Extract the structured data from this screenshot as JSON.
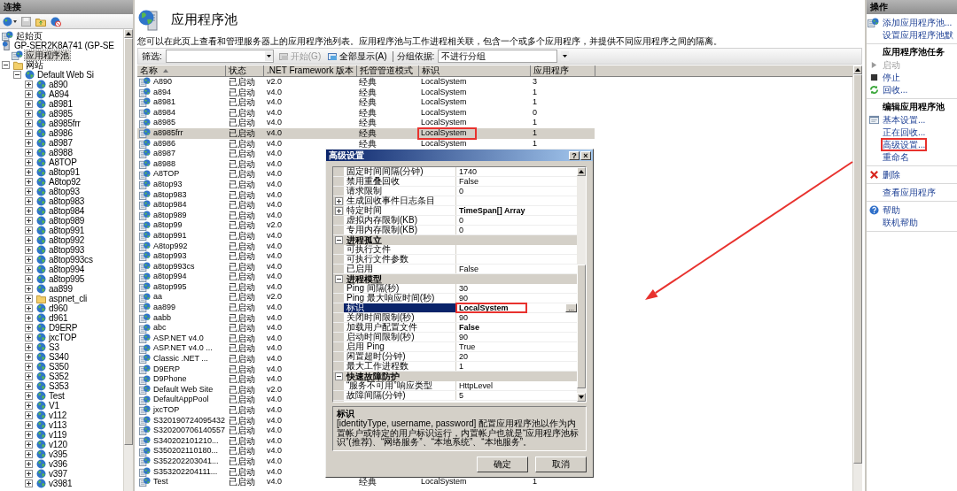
{
  "tree": {
    "title": "连接",
    "items": [
      {
        "label": "起始页",
        "kind": "start",
        "selected": false
      },
      {
        "label": "GP-SER2K8A741 (GP-SE",
        "kind": "server",
        "selected": false,
        "children": [
          {
            "label": "应用程序池",
            "kind": "pools",
            "selected": true
          },
          {
            "label": "网站",
            "kind": "sites",
            "expanded": true,
            "selected": false,
            "children": [
              {
                "label": "Default Web Si",
                "kind": "site",
                "expanded": true,
                "selected": false,
                "children": [
                  {
                    "label": "a890",
                    "kind": "site",
                    "expanded": false,
                    "selected": false
                  },
                  {
                    "label": "A894",
                    "kind": "site",
                    "expanded": false,
                    "selected": false
                  },
                  {
                    "label": "a8981",
                    "kind": "site",
                    "expanded": false,
                    "selected": false
                  },
                  {
                    "label": "a8985",
                    "kind": "site",
                    "expanded": false,
                    "selected": false
                  },
                  {
                    "label": "a8985frr",
                    "kind": "site",
                    "expanded": false,
                    "selected": false
                  },
                  {
                    "label": "a8986",
                    "kind": "site",
                    "expanded": false,
                    "selected": false
                  },
                  {
                    "label": "a8987",
                    "kind": "site",
                    "expanded": false,
                    "selected": false
                  },
                  {
                    "label": "a8988",
                    "kind": "site",
                    "expanded": false,
                    "selected": false
                  },
                  {
                    "label": "A8TOP",
                    "kind": "site",
                    "expanded": false,
                    "selected": false
                  },
                  {
                    "label": "a8top91",
                    "kind": "site",
                    "expanded": false,
                    "selected": false
                  },
                  {
                    "label": "A8top92",
                    "kind": "site",
                    "expanded": false,
                    "selected": false
                  },
                  {
                    "label": "a8top93",
                    "kind": "site",
                    "expanded": false,
                    "selected": false
                  },
                  {
                    "label": "a8top983",
                    "kind": "site",
                    "expanded": false,
                    "selected": false
                  },
                  {
                    "label": "a8top984",
                    "kind": "site",
                    "expanded": false,
                    "selected": false
                  },
                  {
                    "label": "a8top989",
                    "kind": "site",
                    "expanded": false,
                    "selected": false
                  },
                  {
                    "label": "a8top991",
                    "kind": "site",
                    "expanded": false,
                    "selected": false
                  },
                  {
                    "label": "a8top992",
                    "kind": "site",
                    "expanded": false,
                    "selected": false
                  },
                  {
                    "label": "a8top993",
                    "kind": "site",
                    "expanded": false,
                    "selected": false
                  },
                  {
                    "label": "a8top993cs",
                    "kind": "site",
                    "expanded": false,
                    "selected": false
                  },
                  {
                    "label": "a8top994",
                    "kind": "site",
                    "expanded": false,
                    "selected": false
                  },
                  {
                    "label": "a8top995",
                    "kind": "site",
                    "expanded": false,
                    "selected": false
                  },
                  {
                    "label": "aa899",
                    "kind": "site",
                    "expanded": false,
                    "selected": false
                  },
                  {
                    "label": "aspnet_cli",
                    "kind": "folder",
                    "expanded": false,
                    "selected": false
                  },
                  {
                    "label": "d960",
                    "kind": "site",
                    "expanded": false,
                    "selected": false
                  },
                  {
                    "label": "d961",
                    "kind": "site",
                    "expanded": false,
                    "selected": false
                  },
                  {
                    "label": "D9ERP",
                    "kind": "site",
                    "expanded": false,
                    "selected": false
                  },
                  {
                    "label": "jxcTOP",
                    "kind": "site",
                    "expanded": false,
                    "selected": false
                  },
                  {
                    "label": "S3",
                    "kind": "site",
                    "expanded": false,
                    "selected": false
                  },
                  {
                    "label": "S340",
                    "kind": "site",
                    "expanded": false,
                    "selected": false
                  },
                  {
                    "label": "S350",
                    "kind": "site",
                    "expanded": false,
                    "selected": false
                  },
                  {
                    "label": "S352",
                    "kind": "site",
                    "expanded": false,
                    "selected": false
                  },
                  {
                    "label": "S353",
                    "kind": "site",
                    "expanded": false,
                    "selected": false
                  },
                  {
                    "label": "Test",
                    "kind": "site",
                    "expanded": false,
                    "selected": false
                  },
                  {
                    "label": "V1",
                    "kind": "site",
                    "expanded": false,
                    "selected": false
                  },
                  {
                    "label": "v112",
                    "kind": "site",
                    "expanded": false,
                    "selected": false
                  },
                  {
                    "label": "v113",
                    "kind": "site",
                    "expanded": false,
                    "selected": false
                  },
                  {
                    "label": "v119",
                    "kind": "site",
                    "expanded": false,
                    "selected": false
                  },
                  {
                    "label": "v120",
                    "kind": "site",
                    "expanded": false,
                    "selected": false
                  },
                  {
                    "label": "v395",
                    "kind": "site",
                    "expanded": false,
                    "selected": false
                  },
                  {
                    "label": "v396",
                    "kind": "site",
                    "expanded": false,
                    "selected": false
                  },
                  {
                    "label": "v397",
                    "kind": "site",
                    "expanded": false,
                    "selected": false
                  },
                  {
                    "label": "v3981",
                    "kind": "site",
                    "expanded": false,
                    "selected": false
                  }
                ]
              }
            ]
          }
        ]
      }
    ]
  },
  "page": {
    "title": "应用程序池",
    "description": "您可以在此页上查看和管理服务器上的应用程序池列表。应用程序池与工作进程相关联，包含一个或多个应用程序，并提供不同应用程序之间的隔离。"
  },
  "toolbar": {
    "filter_label": "筛选:",
    "buttons": [
      {
        "label": "开始(G)",
        "disabled": true
      },
      {
        "label": "全部显示(A)",
        "disabled": false
      }
    ],
    "group_label": "分组依据:",
    "group_value": "不进行分组"
  },
  "table": {
    "columns": [
      {
        "label": "名称",
        "sorted": true
      },
      {
        "label": "状态",
        "sorted": false
      },
      {
        "label": ".NET Framework 版本",
        "sorted": false
      },
      {
        "label": "托管管道模式",
        "sorted": false
      },
      {
        "label": "标识",
        "sorted": false
      },
      {
        "label": "应用程序",
        "sorted": false
      }
    ],
    "rows": [
      {
        "name": "A890",
        "status": "已启动",
        "version": "v2.0",
        "pipeline": "经典",
        "identity": "LocalSystem",
        "apps": "3",
        "selected": false
      },
      {
        "name": "a894",
        "status": "已启动",
        "version": "v4.0",
        "pipeline": "经典",
        "identity": "LocalSystem",
        "apps": "1",
        "selected": false
      },
      {
        "name": "a8981",
        "status": "已启动",
        "version": "v4.0",
        "pipeline": "经典",
        "identity": "LocalSystem",
        "apps": "1",
        "selected": false
      },
      {
        "name": "a8984",
        "status": "已启动",
        "version": "v4.0",
        "pipeline": "经典",
        "identity": "LocalSystem",
        "apps": "0",
        "selected": false
      },
      {
        "name": "a8985",
        "status": "已启动",
        "version": "v4.0",
        "pipeline": "经典",
        "identity": "LocalSystem",
        "apps": "1",
        "selected": false
      },
      {
        "name": "a8985frr",
        "status": "已启动",
        "version": "v4.0",
        "pipeline": "经典",
        "identity": "LocalSystem",
        "apps": "1",
        "selected": true,
        "highlight": true
      },
      {
        "name": "a8986",
        "status": "已启动",
        "version": "v4.0",
        "pipeline": "经典",
        "identity": "LocalSystem",
        "apps": "1",
        "selected": false
      },
      {
        "name": "a8987",
        "status": "已启动",
        "version": "v4.0",
        "selected": false
      },
      {
        "name": "a8988",
        "status": "已启动",
        "version": "v4.0",
        "selected": false
      },
      {
        "name": "A8TOP",
        "status": "已启动",
        "version": "v4.0",
        "selected": false
      },
      {
        "name": "a8top93",
        "status": "已启动",
        "version": "v4.0",
        "selected": false
      },
      {
        "name": "a8top983",
        "status": "已启动",
        "version": "v4.0",
        "selected": false
      },
      {
        "name": "a8top984",
        "status": "已启动",
        "version": "v4.0",
        "selected": false
      },
      {
        "name": "a8top989",
        "status": "已启动",
        "version": "v4.0",
        "selected": false
      },
      {
        "name": "a8top99",
        "status": "已启动",
        "version": "v2.0",
        "selected": false
      },
      {
        "name": "a8top991",
        "status": "已启动",
        "version": "v4.0",
        "selected": false
      },
      {
        "name": "A8top992",
        "status": "已启动",
        "version": "v4.0",
        "selected": false
      },
      {
        "name": "a8top993",
        "status": "已启动",
        "version": "v4.0",
        "selected": false
      },
      {
        "name": "a8top993cs",
        "status": "已启动",
        "version": "v4.0",
        "selected": false
      },
      {
        "name": "a8top994",
        "status": "已启动",
        "version": "v4.0",
        "selected": false
      },
      {
        "name": "a8top995",
        "status": "已启动",
        "version": "v4.0",
        "selected": false
      },
      {
        "name": "aa",
        "status": "已启动",
        "version": "v2.0",
        "selected": false
      },
      {
        "name": "aa899",
        "status": "已启动",
        "version": "v4.0",
        "selected": false
      },
      {
        "name": "aabb",
        "status": "已启动",
        "version": "v4.0",
        "selected": false
      },
      {
        "name": "abc",
        "status": "已启动",
        "version": "v4.0",
        "selected": false
      },
      {
        "name": "ASP.NET v4.0",
        "status": "已启动",
        "version": "v4.0",
        "selected": false
      },
      {
        "name": "ASP.NET v4.0 ...",
        "status": "已启动",
        "version": "v4.0",
        "selected": false
      },
      {
        "name": "Classic .NET ...",
        "status": "已启动",
        "version": "v4.0",
        "selected": false
      },
      {
        "name": "D9ERP",
        "status": "已启动",
        "version": "v4.0",
        "selected": false
      },
      {
        "name": "D9Phone",
        "status": "已启动",
        "version": "v4.0",
        "selected": false
      },
      {
        "name": "Default Web Site",
        "status": "已启动",
        "version": "v2.0",
        "selected": false
      },
      {
        "name": "DefaultAppPool",
        "status": "已启动",
        "version": "v4.0",
        "selected": false
      },
      {
        "name": "jxcTOP",
        "status": "已启动",
        "version": "v4.0",
        "selected": false
      },
      {
        "name": "S320190724095432",
        "status": "已启动",
        "version": "v4.0",
        "selected": false
      },
      {
        "name": "S320200706140557",
        "status": "已启动",
        "version": "v4.0",
        "selected": false
      },
      {
        "name": "S340202101210...",
        "status": "已启动",
        "version": "v4.0",
        "selected": false
      },
      {
        "name": "S350202110180...",
        "status": "已启动",
        "version": "v4.0",
        "selected": false
      },
      {
        "name": "S352202203041...",
        "status": "已启动",
        "version": "v4.0",
        "selected": false
      },
      {
        "name": "S353202204111...",
        "status": "已启动",
        "version": "v4.0",
        "selected": false
      },
      {
        "name": "Test",
        "status": "已启动",
        "version": "v4.0",
        "pipeline": "经典",
        "identity": "LocalSystem",
        "apps": "1",
        "selected": false
      }
    ]
  },
  "dialog": {
    "title": "高级设置",
    "title_buttons": [
      "?",
      "×"
    ],
    "properties": [
      {
        "kind": "property",
        "name": "固定时间间隔(分钟)",
        "value": "1740",
        "selected": false
      },
      {
        "kind": "property",
        "name": "禁用重叠回收",
        "value": "False",
        "selected": false
      },
      {
        "kind": "property",
        "name": "请求限制",
        "value": "0",
        "selected": false
      },
      {
        "kind": "property",
        "name": "生成回收事件日志条目",
        "expanded": false,
        "selected": false
      },
      {
        "kind": "property",
        "name": "特定时间",
        "value": "TimeSpan[] Array",
        "expanded": false,
        "modified": true,
        "selected": false
      },
      {
        "kind": "property",
        "name": "虚拟内存限制(KB)",
        "value": "0",
        "selected": false
      },
      {
        "kind": "property",
        "name": "专用内存限制(KB)",
        "value": "0",
        "selected": false
      },
      {
        "kind": "category",
        "name": "进程孤立",
        "expanded": true,
        "selected": false
      },
      {
        "kind": "property",
        "name": "可执行文件",
        "selected": false
      },
      {
        "kind": "property",
        "name": "可执行文件参数",
        "selected": false
      },
      {
        "kind": "property",
        "name": "已启用",
        "value": "False",
        "selected": false
      },
      {
        "kind": "category",
        "name": "进程模型",
        "expanded": true,
        "selected": false
      },
      {
        "kind": "property",
        "name": "Ping 间隔(秒)",
        "value": "30",
        "selected": false
      },
      {
        "kind": "property",
        "name": "Ping 最大响应时间(秒)",
        "value": "90",
        "selected": false
      },
      {
        "kind": "property",
        "name": "标识",
        "value": "LocalSystem",
        "modified": true,
        "selected": true,
        "highlight": true,
        "button": "..."
      },
      {
        "kind": "property",
        "name": "关闭时间限制(秒)",
        "value": "90",
        "selected": false
      },
      {
        "kind": "property",
        "name": "加载用户配置文件",
        "value": "False",
        "modified": true,
        "selected": false
      },
      {
        "kind": "property",
        "name": "启动时间限制(秒)",
        "value": "90",
        "selected": false
      },
      {
        "kind": "property",
        "name": "启用 Ping",
        "value": "True",
        "selected": false
      },
      {
        "kind": "property",
        "name": "闲置超时(分钟)",
        "value": "20",
        "selected": false
      },
      {
        "kind": "property",
        "name": "最大工作进程数",
        "value": "1",
        "selected": false
      },
      {
        "kind": "category",
        "name": "快速故障防护",
        "expanded": true,
        "selected": false
      },
      {
        "kind": "property",
        "name": "“服务不可用”响应类型",
        "value": "HttpLevel",
        "selected": false
      },
      {
        "kind": "property",
        "name": "故障间隔(分钟)",
        "value": "5",
        "selected": false
      }
    ],
    "description": {
      "title": "标识",
      "text": "[identityType, username, password] 配置应用程序池以作为内置帐户或特定的用户标识运行，内置帐户也就是“应用程序池标识”(推荐)、“网络服务”、“本地系统”、“本地服务”。"
    },
    "buttons": [
      "确定",
      "取消"
    ]
  },
  "actions": {
    "title": "操作",
    "sections": [
      {
        "items": [
          {
            "label": "添加应用程序池...",
            "kind": "add",
            "disabled": false
          },
          {
            "label": "设置应用程序池默",
            "kind": "link",
            "disabled": false
          }
        ]
      },
      {
        "heading": "应用程序池任务",
        "items": [
          {
            "label": "启动",
            "kind": "start",
            "disabled": true
          },
          {
            "label": "停止",
            "kind": "stop",
            "disabled": false
          },
          {
            "label": "回收...",
            "kind": "recycle",
            "disabled": false
          }
        ]
      },
      {
        "heading": "编辑应用程序池",
        "items": [
          {
            "label": "基本设置...",
            "kind": "settings",
            "disabled": false
          },
          {
            "label": "正在回收...",
            "kind": "link",
            "disabled": false
          },
          {
            "label": "高级设置...",
            "kind": "link",
            "disabled": false,
            "highlight": true
          },
          {
            "label": "重命名",
            "kind": "link",
            "disabled": false
          }
        ]
      },
      {
        "items": [
          {
            "label": "删除",
            "kind": "delete",
            "disabled": false
          }
        ]
      },
      {
        "items": [
          {
            "label": "查看应用程序",
            "kind": "link",
            "disabled": false
          }
        ]
      },
      {
        "items": [
          {
            "label": "帮助",
            "kind": "help",
            "disabled": false
          },
          {
            "label": "联机帮助",
            "kind": "link",
            "disabled": false
          }
        ]
      }
    ]
  }
}
